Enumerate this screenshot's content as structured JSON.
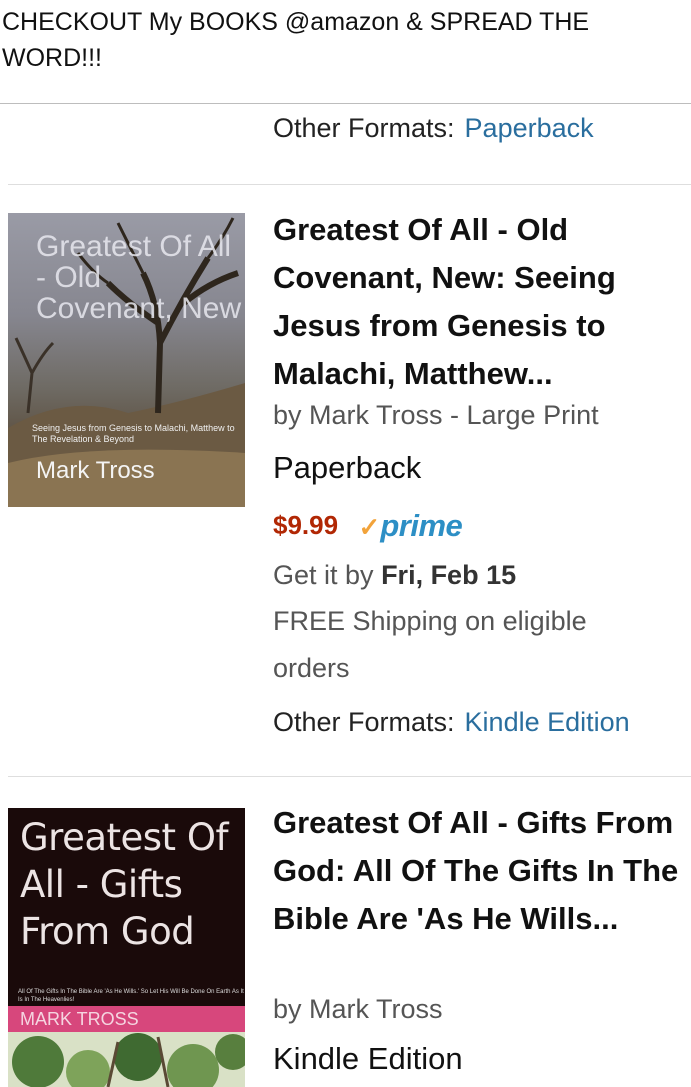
{
  "post": {
    "caption": "CHECKOUT My BOOKS @amazon & SPREAD THE WORD!!!"
  },
  "items": [
    {
      "other_formats_label": "Other Formats:",
      "other_formats_link": "Paperback"
    },
    {
      "title": "Greatest Of All - Old Covenant, New: Seeing Jesus from Genesis to Malachi, Matthew...",
      "byline": "by Mark Tross - Large Print",
      "binding": "Paperback",
      "price": "$9.99",
      "prime_check": "✓",
      "prime_word": "prime",
      "delivery_prefix": "Get it by",
      "delivery_date": "Fri, Feb 15",
      "shipping": "FREE Shipping on eligible orders",
      "other_formats_label": "Other Formats:",
      "other_formats_link": "Kindle Edition",
      "cover": {
        "title": "Greatest Of All - Old Covenant, New",
        "subtitle": "Seeing Jesus from Genesis to Malachi, Matthew to The Revelation & Beyond",
        "author": "Mark Tross"
      }
    },
    {
      "title": "Greatest Of All - Gifts From God: All Of The Gifts In The Bible Are 'As He Wills...",
      "byline": "by Mark Tross",
      "binding": "Kindle Edition",
      "cover": {
        "title": "Greatest Of All - Gifts From God",
        "subtitle": "All Of The Gifts In The Bible Are 'As He Wills.' So Let His Will Be Done On Earth As It Is In The Heavenlies!",
        "author": "MARK TROSS"
      }
    }
  ],
  "colors": {
    "price": "#b12704",
    "link": "#2a6e9e",
    "prime_check": "#f2a33a",
    "prime_word": "#2d8fc5",
    "cover2_band": "#d7477c"
  }
}
